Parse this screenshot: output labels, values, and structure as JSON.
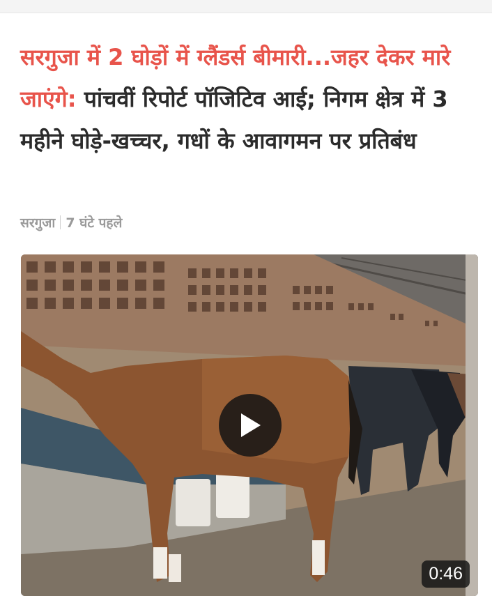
{
  "headline": {
    "highlight": "सरगुजा में 2 घोड़ों में ग्लैंडर्स बीमारी...जहर देकर मारे जाएंगे:",
    "rest": " पांचवीं रिपोर्ट पॉजिटिव आई; निगम क्षेत्र में 3 महीने घोड़े-खच्चर, गधों के आवागमन पर प्रतिबंध"
  },
  "meta": {
    "location": "सरगुजा",
    "time": "7 घंटे पहले"
  },
  "video": {
    "duration": "0:46",
    "play_icon": "play-icon"
  },
  "colors": {
    "highlight": "#e8544b",
    "text": "#2b2b2b",
    "meta": "#9a9a9a"
  }
}
